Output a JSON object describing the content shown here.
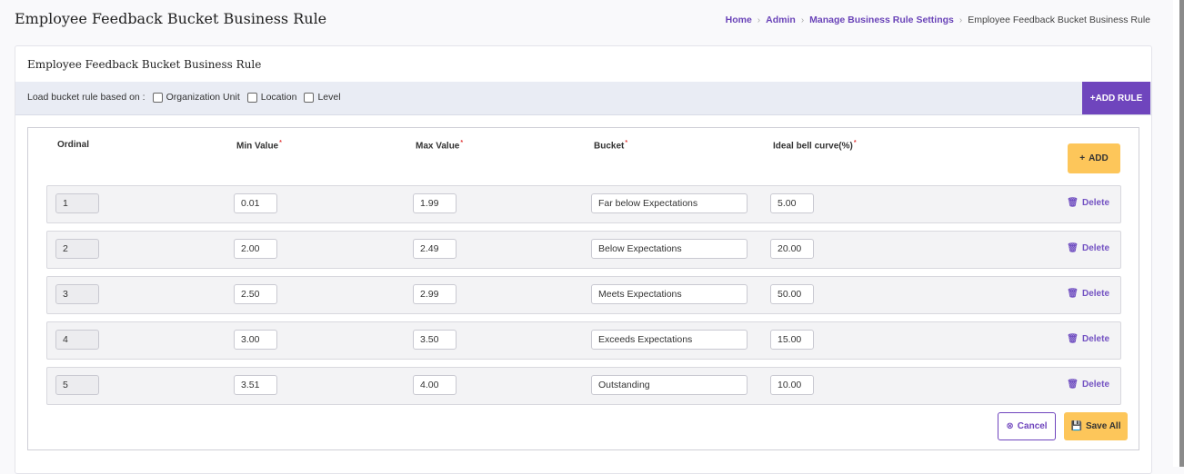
{
  "header": {
    "title": "Employee Feedback Bucket Business Rule",
    "breadcrumb": {
      "home": "Home",
      "admin": "Admin",
      "settings": "Manage Business Rule Settings",
      "current": "Employee Feedback Bucket Business Rule"
    }
  },
  "card": {
    "title": "Employee Feedback Bucket Business Rule",
    "filter": {
      "label": "Load bucket rule based on :",
      "options": [
        "Organization Unit",
        "Location",
        "Level"
      ]
    },
    "add_rule_label": "+ADD RULE"
  },
  "table": {
    "headers": {
      "ordinal": "Ordinal",
      "min": "Min Value",
      "max": "Max Value",
      "bucket": "Bucket",
      "bell": "Ideal bell curve(%)",
      "required_mark": "*"
    },
    "add_label": "ADD",
    "delete_label": "Delete",
    "rows": [
      {
        "ordinal": "1",
        "min": "0.01",
        "max": "1.99",
        "bucket": "Far below Expectations",
        "bell": "5.00"
      },
      {
        "ordinal": "2",
        "min": "2.00",
        "max": "2.49",
        "bucket": "Below Expectations",
        "bell": "20.00"
      },
      {
        "ordinal": "3",
        "min": "2.50",
        "max": "2.99",
        "bucket": "Meets Expectations",
        "bell": "50.00"
      },
      {
        "ordinal": "4",
        "min": "3.00",
        "max": "3.50",
        "bucket": "Exceeds Expectations",
        "bell": "15.00"
      },
      {
        "ordinal": "5",
        "min": "3.51",
        "max": "4.00",
        "bucket": "Outstanding",
        "bell": "10.00"
      }
    ],
    "cancel_label": "Cancel",
    "save_label": "Save All"
  },
  "icons": {
    "plus": "+",
    "trash": "🗑",
    "cancel": "⊗",
    "save": "💾",
    "chevron": "›"
  },
  "colors": {
    "accent": "#6f45bd",
    "warning": "#fdc65a"
  }
}
